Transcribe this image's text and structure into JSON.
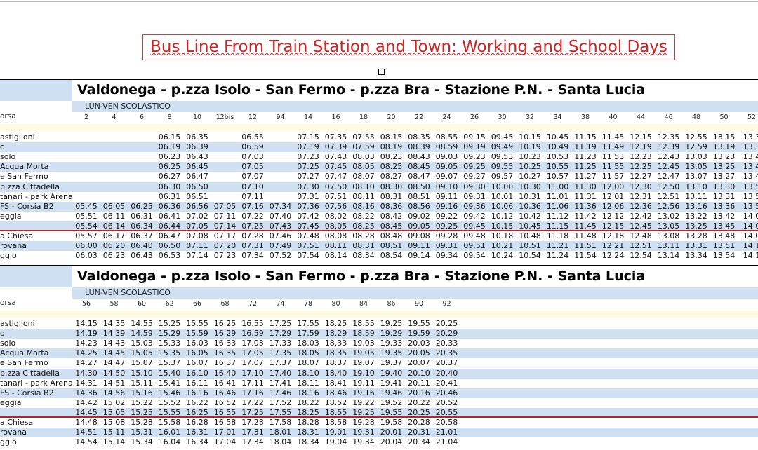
{
  "page_title": "Bus Line From Train Station and Town: Working and School Days",
  "tables": [
    {
      "title": "Valdonega - p.zza Isolo - San Fermo - p.zza Bra - Stazione P.N. - Santa Lucia",
      "subtitle": "LUN-VEN SCOLASTICO",
      "corsa_label": "orsa",
      "runs": [
        "2",
        "4",
        "6",
        "8",
        "10",
        "12bis",
        "12",
        "94",
        "14",
        "16",
        "18",
        "20",
        "22",
        "24",
        "26",
        "30",
        "32",
        "34",
        "38",
        "40",
        "44",
        "46",
        "48",
        "50",
        "52"
      ],
      "stops": [
        {
          "name": "astiglioni",
          "times": [
            "",
            "",
            "",
            "06.15",
            "06.35",
            "",
            "06.55",
            "",
            "07.15",
            "07.35",
            "07.55",
            "08.15",
            "08.35",
            "08.55",
            "09.15",
            "09.45",
            "10.15",
            "10.45",
            "11.15",
            "11.45",
            "12.15",
            "12.35",
            "12.55",
            "13.15",
            "13.3"
          ]
        },
        {
          "name": "o",
          "times": [
            "",
            "",
            "",
            "06.19",
            "06.39",
            "",
            "06.59",
            "",
            "07.19",
            "07.39",
            "07.59",
            "08.19",
            "08.39",
            "08.59",
            "09.19",
            "09.49",
            "10.19",
            "10.49",
            "11.19",
            "11.49",
            "12.19",
            "12.39",
            "12.59",
            "13.19",
            "13.3"
          ]
        },
        {
          "name": "solo",
          "times": [
            "",
            "",
            "",
            "06.23",
            "06.43",
            "",
            "07.03",
            "",
            "07.23",
            "07.43",
            "08.03",
            "08.23",
            "08.43",
            "09.03",
            "09.23",
            "09.53",
            "10.23",
            "10.53",
            "11.23",
            "11.53",
            "12.23",
            "12.43",
            "13.03",
            "13.23",
            "13.4"
          ]
        },
        {
          "name": "Acqua Morta",
          "times": [
            "",
            "",
            "",
            "06.25",
            "06.45",
            "",
            "07.05",
            "",
            "07.25",
            "07.45",
            "08.05",
            "08.25",
            "08.45",
            "09.05",
            "09.25",
            "09.55",
            "10.25",
            "10.55",
            "11.25",
            "11.55",
            "12.25",
            "12.45",
            "13.05",
            "13.25",
            "13.4"
          ]
        },
        {
          "name": "e San Fermo",
          "times": [
            "",
            "",
            "",
            "06.27",
            "06.47",
            "",
            "07.07",
            "",
            "07.27",
            "07.47",
            "08.07",
            "08.27",
            "08.47",
            "09.07",
            "09.27",
            "09.57",
            "10.27",
            "10.57",
            "11.27",
            "11.57",
            "12.27",
            "12.47",
            "13.07",
            "13.27",
            "13.4"
          ]
        },
        {
          "name": "p.zza Cittadella",
          "times": [
            "",
            "",
            "",
            "06.30",
            "06.50",
            "",
            "07.10",
            "",
            "07.30",
            "07.50",
            "08.10",
            "08.30",
            "08.50",
            "09.10",
            "09.30",
            "10.00",
            "10.30",
            "11.00",
            "11.30",
            "12.00",
            "12.30",
            "12.50",
            "13.10",
            "13.30",
            "13.5"
          ]
        },
        {
          "name": "tanari - park Arena",
          "times": [
            "",
            "",
            "",
            "06.31",
            "06.51",
            "",
            "07.11",
            "",
            "07.31",
            "07.51",
            "08.11",
            "08.31",
            "08.51",
            "09.11",
            "09.31",
            "10.01",
            "10.31",
            "11.01",
            "11.31",
            "12.01",
            "12.31",
            "12.51",
            "13.11",
            "13.31",
            "13.5"
          ]
        },
        {
          "name": "FS - Corsia B2",
          "times": [
            "05.45",
            "06.05",
            "06.25",
            "06.36",
            "06.56",
            "07.05",
            "07.16",
            "07.34",
            "07.36",
            "07.56",
            "08.16",
            "08.36",
            "08.56",
            "09.16",
            "09.36",
            "10.06",
            "10.36",
            "11.06",
            "11.36",
            "12.06",
            "12.36",
            "12.56",
            "13.16",
            "13.36",
            "13.5"
          ]
        },
        {
          "name": "eggia",
          "times": [
            "05.51",
            "06.11",
            "06.31",
            "06.41",
            "07.02",
            "07.11",
            "07.22",
            "07.40",
            "07.42",
            "08.02",
            "08.22",
            "08.42",
            "09.02",
            "09.22",
            "09.42",
            "10.12",
            "10.42",
            "11.12",
            "11.42",
            "12.12",
            "12.42",
            "13.02",
            "13.22",
            "13.42",
            "14.0"
          ]
        },
        {
          "name": "",
          "times": [
            "05.54",
            "06.14",
            "06.34",
            "06.44",
            "07.05",
            "07.14",
            "07.25",
            "07.43",
            "07.45",
            "08.05",
            "08.25",
            "08.45",
            "09.05",
            "09.25",
            "09.45",
            "10.15",
            "10.45",
            "11.15",
            "11.45",
            "12.15",
            "12.45",
            "13.05",
            "13.25",
            "13.45",
            "14.0"
          ]
        },
        {
          "name": "a Chiesa",
          "times": [
            "05.57",
            "06.17",
            "06.37",
            "06.47",
            "07.08",
            "07.17",
            "07.28",
            "07.46",
            "07.48",
            "08.08",
            "08.28",
            "08.48",
            "09.08",
            "09.28",
            "09.48",
            "10.18",
            "10.48",
            "11.18",
            "11.48",
            "12.18",
            "12.48",
            "13.08",
            "13.28",
            "13.48",
            "14.0"
          ]
        },
        {
          "name": "rovana",
          "times": [
            "06.00",
            "06.20",
            "06.40",
            "06.50",
            "07.11",
            "07.20",
            "07.31",
            "07.49",
            "07.51",
            "08.11",
            "08.31",
            "08.51",
            "09.11",
            "09.31",
            "09.51",
            "10.21",
            "10.51",
            "11.21",
            "11.51",
            "12.21",
            "12.51",
            "13.11",
            "13.31",
            "13.51",
            "14.1"
          ]
        },
        {
          "name": "ggio",
          "times": [
            "06.03",
            "06.23",
            "06.43",
            "06.53",
            "07.14",
            "07.23",
            "07.34",
            "07.52",
            "07.54",
            "08.14",
            "08.34",
            "08.54",
            "09.14",
            "09.34",
            "09.54",
            "10.24",
            "10.54",
            "11.24",
            "11.54",
            "12.24",
            "12.54",
            "13.14",
            "13.34",
            "13.54",
            "14.1"
          ]
        }
      ]
    },
    {
      "title": "Valdonega - p.zza Isolo - San Fermo - p.zza Bra - Stazione P.N. - Santa Lucia",
      "subtitle": "LUN-VEN SCOLASTICO",
      "corsa_label": "orsa",
      "runs": [
        "56",
        "58",
        "60",
        "62",
        "66",
        "68",
        "72",
        "74",
        "78",
        "80",
        "84",
        "86",
        "90",
        "92"
      ],
      "stops": [
        {
          "name": "astiglioni",
          "times": [
            "14.15",
            "14.35",
            "14.55",
            "15.25",
            "15.55",
            "16.25",
            "16.55",
            "17.25",
            "17.55",
            "18.25",
            "18.55",
            "19.25",
            "19.55",
            "20.25"
          ]
        },
        {
          "name": "o",
          "times": [
            "14.19",
            "14.39",
            "14.59",
            "15.29",
            "15.59",
            "16.29",
            "16.59",
            "17.29",
            "17.59",
            "18.29",
            "18.59",
            "19.29",
            "19.59",
            "20.29"
          ]
        },
        {
          "name": "solo",
          "times": [
            "14.23",
            "14.43",
            "15.03",
            "15.33",
            "16.03",
            "16.33",
            "17.03",
            "17.33",
            "18.03",
            "18.33",
            "19.03",
            "19.33",
            "20.03",
            "20.33"
          ]
        },
        {
          "name": "Acqua Morta",
          "times": [
            "14.25",
            "14.45",
            "15.05",
            "15.35",
            "16.05",
            "16.35",
            "17.05",
            "17.35",
            "18.05",
            "18.35",
            "19.05",
            "19.35",
            "20.05",
            "20.35"
          ]
        },
        {
          "name": "e San Fermo",
          "times": [
            "14.27",
            "14.47",
            "15.07",
            "15.37",
            "16.07",
            "16.37",
            "17.07",
            "17.37",
            "18.07",
            "18.37",
            "19.07",
            "19.37",
            "20.07",
            "20.37"
          ]
        },
        {
          "name": "p.zza Cittadella",
          "times": [
            "14.30",
            "14.50",
            "15.10",
            "15.40",
            "16.10",
            "16.40",
            "17.10",
            "17.40",
            "18.10",
            "18.40",
            "19.10",
            "19.40",
            "20.10",
            "20.40"
          ]
        },
        {
          "name": "tanari - park Arena",
          "times": [
            "14.31",
            "14.51",
            "15.11",
            "15.41",
            "16.11",
            "16.41",
            "17.11",
            "17.41",
            "18.11",
            "18.41",
            "19.11",
            "19.41",
            "20.11",
            "20.41"
          ]
        },
        {
          "name": "FS - Corsia B2",
          "times": [
            "14.36",
            "14.56",
            "15.16",
            "15.46",
            "16.16",
            "16.46",
            "17.16",
            "17.46",
            "18.16",
            "18.46",
            "19.16",
            "19.46",
            "20.16",
            "20.46"
          ]
        },
        {
          "name": "eggia",
          "times": [
            "14.42",
            "15.02",
            "15.22",
            "15.52",
            "16.22",
            "16.52",
            "17.22",
            "17.52",
            "18.22",
            "18.52",
            "19.22",
            "19.52",
            "20.22",
            "20.52"
          ]
        },
        {
          "name": "",
          "times": [
            "14.45",
            "15.05",
            "15.25",
            "15.55",
            "16.25",
            "16.55",
            "17.25",
            "17.55",
            "18.25",
            "18.55",
            "19.25",
            "19.55",
            "20.25",
            "20.55"
          ]
        },
        {
          "name": "a Chiesa",
          "times": [
            "14.48",
            "15.08",
            "15.28",
            "15.58",
            "16.28",
            "16.58",
            "17.28",
            "17.58",
            "18.28",
            "18.58",
            "19.28",
            "19.58",
            "20.28",
            "20.58"
          ]
        },
        {
          "name": "rovana",
          "times": [
            "14.51",
            "15.11",
            "15.31",
            "16.01",
            "16.31",
            "17.01",
            "17.31",
            "18.01",
            "18.31",
            "19.01",
            "19.31",
            "20.01",
            "20.31",
            "21.01"
          ]
        },
        {
          "name": "ggio",
          "times": [
            "14.54",
            "15.14",
            "15.34",
            "16.04",
            "16.34",
            "17.04",
            "17.34",
            "18.04",
            "18.34",
            "19.04",
            "19.34",
            "20.04",
            "20.34",
            "21.04"
          ]
        }
      ]
    }
  ]
}
